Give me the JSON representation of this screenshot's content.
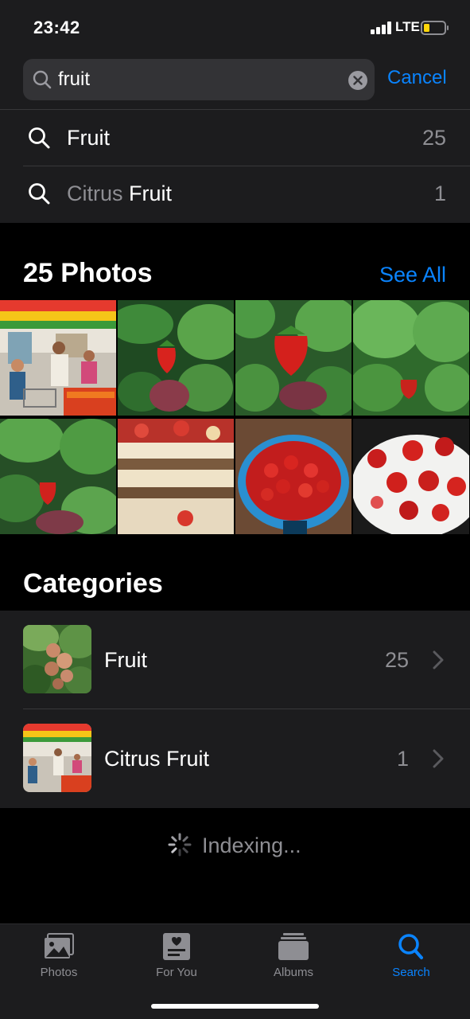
{
  "status_bar": {
    "time": "23:42",
    "network": "LTE",
    "battery_level": 0.2,
    "battery_color": "#ffd60a"
  },
  "search": {
    "value": "fruit",
    "cancel_label": "Cancel",
    "icon": "magnifying-glass-icon",
    "clear_icon": "clear-x-circle-icon"
  },
  "suggestions": [
    {
      "label_dim": "",
      "label_main": "Fruit",
      "count": "25",
      "icon": "search-icon"
    },
    {
      "label_dim": "Citrus ",
      "label_main": "Fruit",
      "count": "1",
      "icon": "search-icon"
    }
  ],
  "photos_section": {
    "title": "25 Photos",
    "see_all_label": "See All",
    "thumbnails": [
      "supermarket-produce-aisle",
      "strawberry-on-plant",
      "strawberry-on-plant-closeup",
      "strawberry-plant-leaves",
      "strawberry-under-leaves",
      "strawberry-layer-cake",
      "blue-bowl-of-strawberries",
      "white-plate-of-strawberries"
    ]
  },
  "categories_section": {
    "title": "Categories",
    "items": [
      {
        "name": "Fruit",
        "count": "25",
        "thumbnail": "peach-tree",
        "icon": "chevron-right-icon"
      },
      {
        "name": "Citrus Fruit",
        "count": "1",
        "thumbnail": "supermarket-produce-aisle",
        "icon": "chevron-right-icon"
      }
    ]
  },
  "indexing": {
    "label": "Indexing...",
    "icon": "activity-spinner-icon"
  },
  "tab_bar": {
    "tabs": [
      {
        "label": "Photos",
        "icon": "photos-icon",
        "active": false
      },
      {
        "label": "For You",
        "icon": "for-you-icon",
        "active": false
      },
      {
        "label": "Albums",
        "icon": "albums-icon",
        "active": false
      },
      {
        "label": "Search",
        "icon": "search-icon",
        "active": true
      }
    ]
  },
  "colors": {
    "accent": "#0a84ff",
    "background": "#000000",
    "grouped_background": "#1c1c1e",
    "secondary_label": "#8e8e93"
  }
}
